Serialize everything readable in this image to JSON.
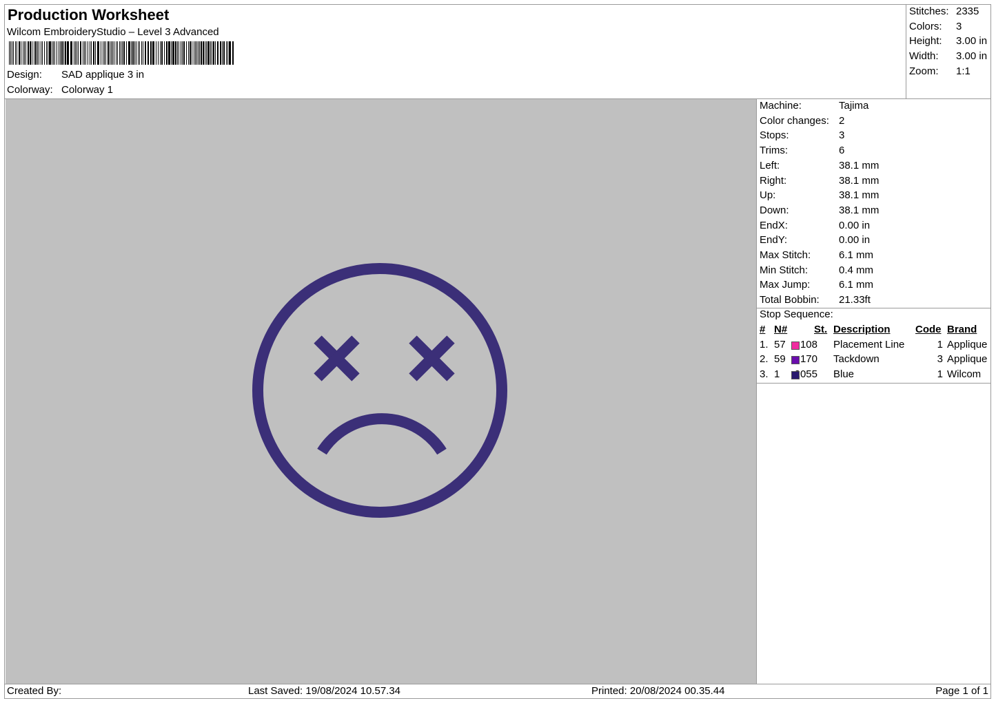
{
  "header": {
    "title": "Production Worksheet",
    "software": "Wilcom EmbroideryStudio – Level 3 Advanced",
    "design_label": "Design:",
    "design_value": "SAD applique 3 in",
    "colorway_label": "Colorway:",
    "colorway_value": "Colorway 1"
  },
  "summary": {
    "stitches_label": "Stitches:",
    "stitches_value": "2335",
    "colors_label": "Colors:",
    "colors_value": "3",
    "height_label": "Height:",
    "height_value": "3.00 in",
    "width_label": "Width:",
    "width_value": "3.00 in",
    "zoom_label": "Zoom:",
    "zoom_value": "1:1"
  },
  "machine_info": [
    {
      "label": "Machine:",
      "value": "Tajima"
    },
    {
      "label": "Color changes:",
      "value": "2"
    },
    {
      "label": "Stops:",
      "value": "3"
    },
    {
      "label": "Trims:",
      "value": "6"
    },
    {
      "label": "Left:",
      "value": "38.1 mm"
    },
    {
      "label": "Right:",
      "value": "38.1 mm"
    },
    {
      "label": "Up:",
      "value": "38.1 mm"
    },
    {
      "label": "Down:",
      "value": "38.1 mm"
    },
    {
      "label": "EndX:",
      "value": "0.00 in"
    },
    {
      "label": "EndY:",
      "value": "0.00 in"
    },
    {
      "label": "Max Stitch:",
      "value": "6.1 mm"
    },
    {
      "label": "Min Stitch:",
      "value": "0.4 mm"
    },
    {
      "label": "Max Jump:",
      "value": "6.1 mm"
    },
    {
      "label": "Total Bobbin:",
      "value": "21.33ft"
    }
  ],
  "stop_sequence": {
    "title": "Stop Sequence:",
    "headers": {
      "num": "#",
      "needle": "N#",
      "stitches": "St.",
      "description": "Description",
      "code": "Code",
      "brand": "Brand"
    },
    "rows": [
      {
        "num": "1.",
        "needle": "57",
        "color": "#f02ca0",
        "stitches": "108",
        "description": "Placement Line",
        "code": "1",
        "brand": "Applique"
      },
      {
        "num": "2.",
        "needle": "59",
        "color": "#6a0dad",
        "stitches": "170",
        "description": "Tackdown",
        "code": "3",
        "brand": "Applique"
      },
      {
        "num": "3.",
        "needle": "1",
        "color": "#2a1a6e",
        "stitches": "2055",
        "description": "Blue",
        "code": "1",
        "brand": "Wilcom"
      }
    ]
  },
  "design_preview": {
    "background": "#c0c0c0",
    "thread_color": "#3b2f78"
  },
  "footer": {
    "created_by": "Created By:",
    "last_saved": "Last Saved: 19/08/2024 10.57.34",
    "printed": "Printed: 20/08/2024 00.35.44",
    "page": "Page 1 of 1"
  }
}
